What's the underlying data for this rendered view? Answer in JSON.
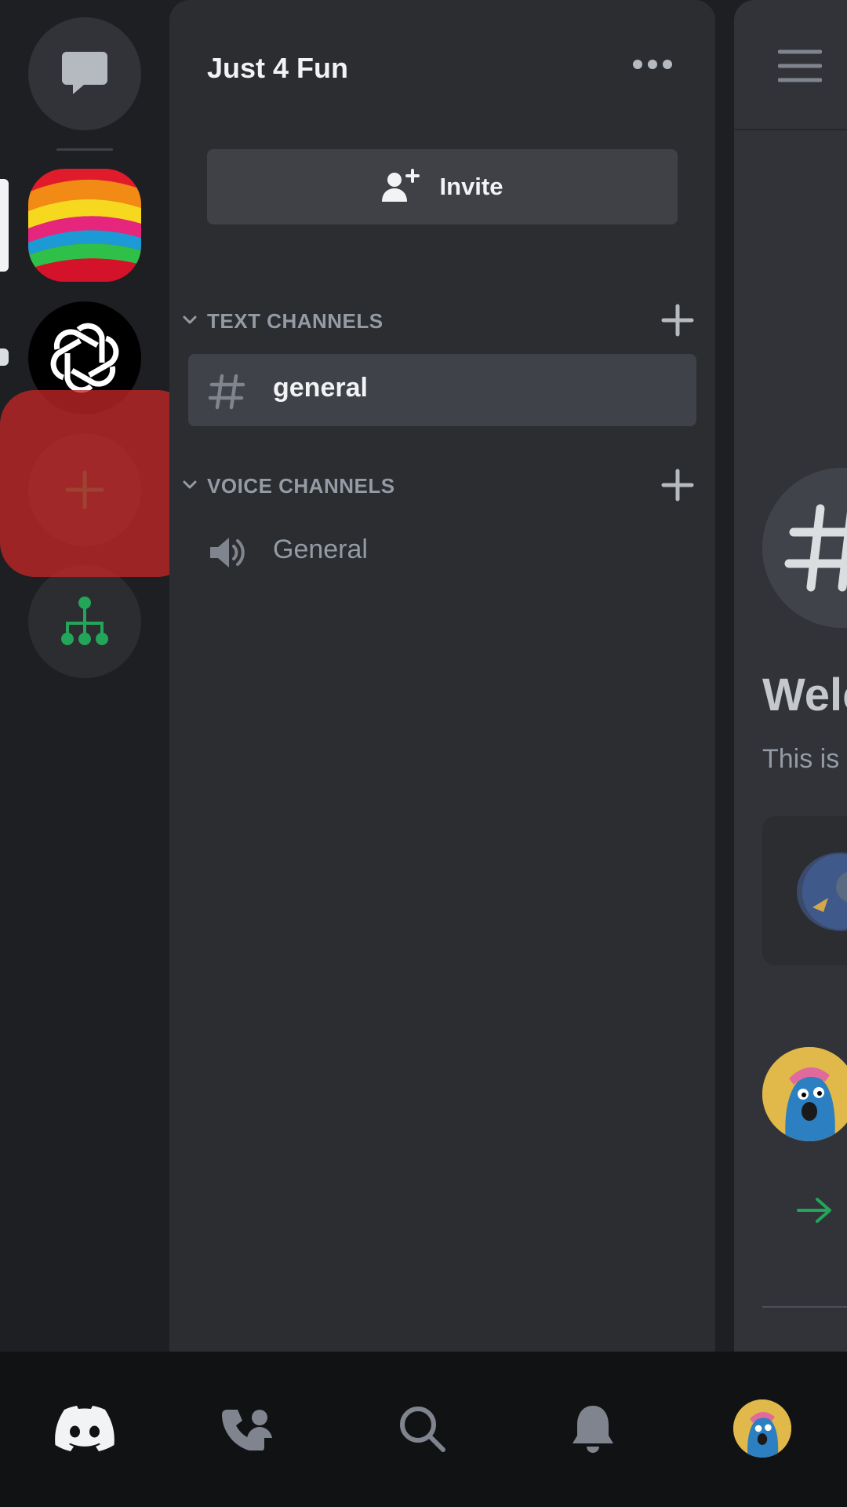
{
  "server": {
    "name": "Just 4 Fun",
    "invite_label": "Invite"
  },
  "categories": {
    "text": "TEXT CHANNELS",
    "voice": "VOICE CHANNELS"
  },
  "channels": {
    "text": [
      {
        "name": "general",
        "icon": "hash-icon",
        "selected": true
      }
    ],
    "voice": [
      {
        "name": "General",
        "icon": "speaker-icon"
      }
    ]
  },
  "rail": {
    "items": [
      {
        "name": "direct-messages",
        "icon": "chat-bubble-icon"
      },
      {
        "name": "server-rainbow",
        "icon": "rainbow-server-icon",
        "selected": true
      },
      {
        "name": "server-openai",
        "icon": "openai-logo-icon",
        "unread": true
      },
      {
        "name": "add-server",
        "icon": "plus-icon"
      },
      {
        "name": "discover",
        "icon": "hierarchy-icon"
      }
    ]
  },
  "chat_peek": {
    "welcome_text": "Welc",
    "subtitle": "This is"
  },
  "bottom_nav": {
    "items": [
      "discord-logo-icon",
      "friends-icon",
      "search-icon",
      "bell-icon",
      "profile-avatar"
    ]
  },
  "colors": {
    "background": "#1e1f22",
    "panel": "#2b2d31",
    "chat": "#313338",
    "selected_channel": "#404249",
    "muted_text": "#949ba4",
    "brand_green": "#23a55a",
    "tap_highlight": "#c22626"
  }
}
